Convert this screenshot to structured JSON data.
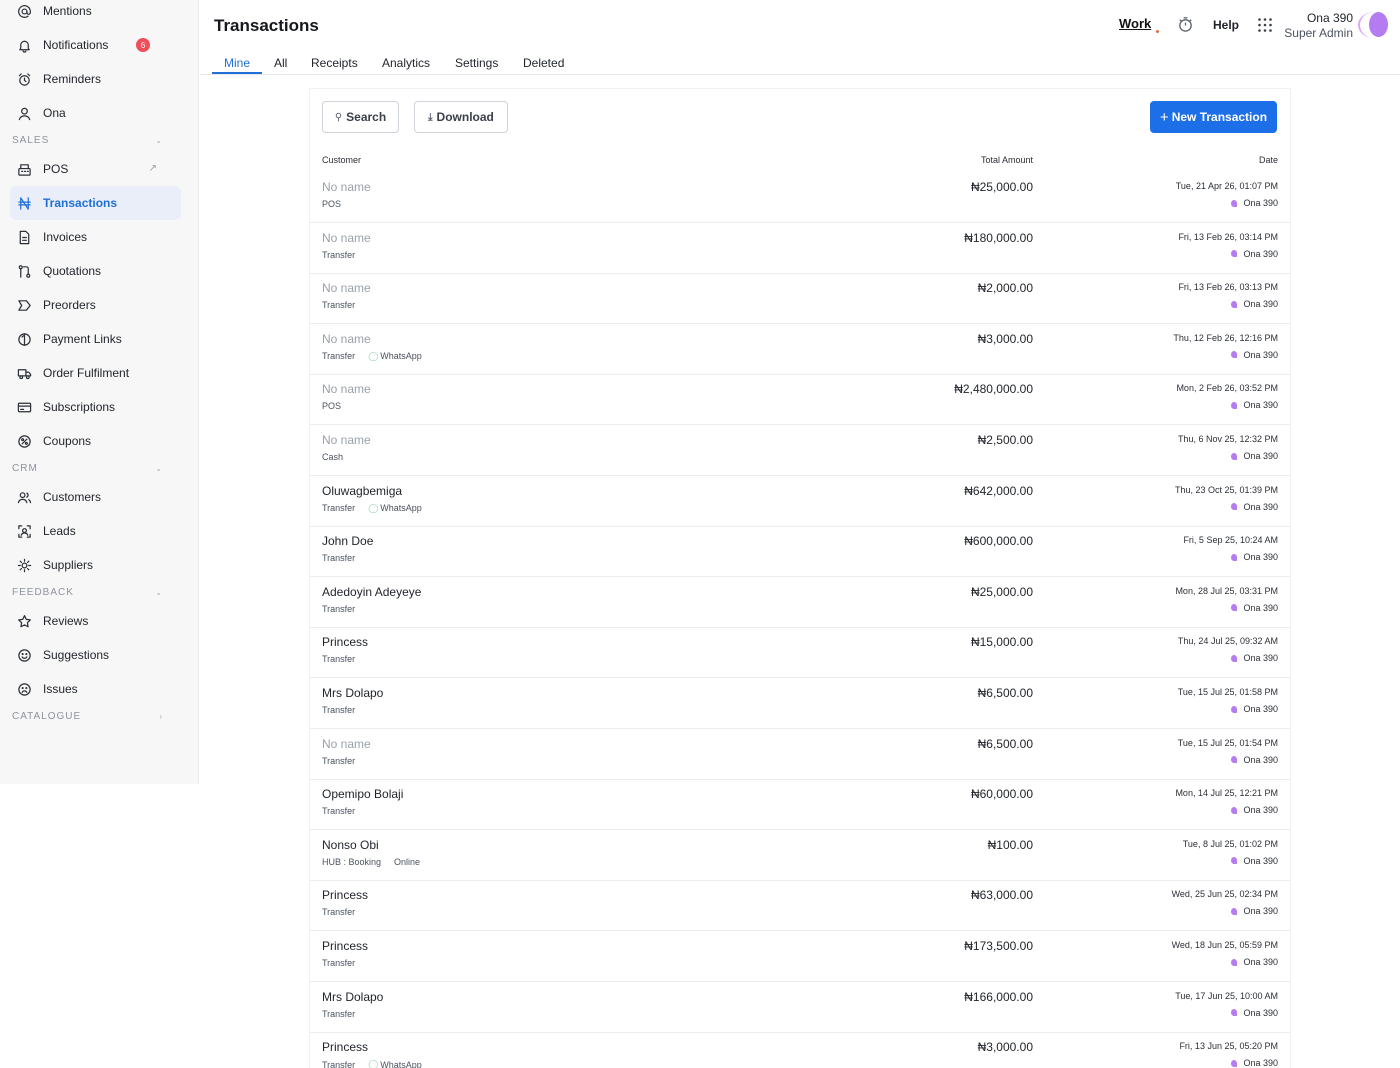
{
  "sidebar": {
    "items_top": [
      {
        "label": "Mentions",
        "icon": "at-icon"
      },
      {
        "label": "Notifications",
        "icon": "bell-icon",
        "badge": "6"
      },
      {
        "label": "Reminders",
        "icon": "alarm-icon"
      },
      {
        "label": "Ona",
        "icon": "user-icon"
      }
    ],
    "sections": [
      {
        "title": "SALES",
        "items": [
          {
            "label": "POS",
            "icon": "pos-icon"
          },
          {
            "label": "Transactions",
            "icon": "naira-icon"
          },
          {
            "label": "Invoices",
            "icon": "invoice-icon"
          },
          {
            "label": "Quotations",
            "icon": "quotation-icon"
          },
          {
            "label": "Preorders",
            "icon": "preorder-icon"
          },
          {
            "label": "Payment Links",
            "icon": "payment-link-icon"
          },
          {
            "label": "Order Fulfilment",
            "icon": "truck-icon"
          },
          {
            "label": "Subscriptions",
            "icon": "card-icon"
          },
          {
            "label": "Coupons",
            "icon": "coupon-icon"
          }
        ]
      },
      {
        "title": "CRM",
        "items": [
          {
            "label": "Customers",
            "icon": "users-icon"
          },
          {
            "label": "Leads",
            "icon": "lead-icon"
          },
          {
            "label": "Suppliers",
            "icon": "supplier-icon"
          }
        ]
      },
      {
        "title": "FEEDBACK",
        "items": [
          {
            "label": "Reviews",
            "icon": "star-icon"
          },
          {
            "label": "Suggestions",
            "icon": "smile-icon"
          },
          {
            "label": "Issues",
            "icon": "frown-icon"
          }
        ]
      },
      {
        "title": "CATALOGUE",
        "items": []
      }
    ],
    "chevron_down": "⌄",
    "chevron_right": "›",
    "external_arrow": "↗"
  },
  "header": {
    "title": "Transactions",
    "work_label": "Work",
    "help_label": "Help",
    "user_name": "Ona 390",
    "user_role": "Super Admin"
  },
  "tabs": [
    "Mine",
    "All",
    "Receipts",
    "Analytics",
    "Settings",
    "Deleted"
  ],
  "toolbar": {
    "search_label": "Search",
    "download_label": "Download",
    "new_label": "New Transaction",
    "search_glyph": "⚲",
    "download_glyph": "⤓",
    "plus_glyph": "+"
  },
  "table": {
    "columns": {
      "customer": "Customer",
      "amount": "Total Amount",
      "date": "Date"
    },
    "rows": [
      {
        "customer": "No name",
        "muted": true,
        "method": "POS",
        "tag": "",
        "amount": "₦25,000.00",
        "date": "Tue, 21 Apr 26, 01:07 PM",
        "by": "Ona 390"
      },
      {
        "customer": "No name",
        "muted": true,
        "method": "Transfer",
        "tag": "",
        "amount": "₦180,000.00",
        "date": "Fri, 13 Feb 26, 03:14 PM",
        "by": "Ona 390"
      },
      {
        "customer": "No name",
        "muted": true,
        "method": "Transfer",
        "tag": "",
        "amount": "₦2,000.00",
        "date": "Fri, 13 Feb 26, 03:13 PM",
        "by": "Ona 390"
      },
      {
        "customer": "No name",
        "muted": true,
        "method": "Transfer",
        "tag": "WhatsApp",
        "amount": "₦3,000.00",
        "date": "Thu, 12 Feb 26, 12:16 PM",
        "by": "Ona 390"
      },
      {
        "customer": "No name",
        "muted": true,
        "method": "POS",
        "tag": "",
        "amount": "₦2,480,000.00",
        "date": "Mon, 2 Feb 26, 03:52 PM",
        "by": "Ona 390"
      },
      {
        "customer": "No name",
        "muted": true,
        "method": "Cash",
        "tag": "",
        "amount": "₦2,500.00",
        "date": "Thu, 6 Nov 25, 12:32 PM",
        "by": "Ona 390"
      },
      {
        "customer": "Oluwagbemiga",
        "muted": false,
        "method": "Transfer",
        "tag": "WhatsApp",
        "amount": "₦642,000.00",
        "date": "Thu, 23 Oct 25, 01:39 PM",
        "by": "Ona 390"
      },
      {
        "customer": "John Doe",
        "muted": false,
        "method": "Transfer",
        "tag": "",
        "amount": "₦600,000.00",
        "date": "Fri, 5 Sep 25, 10:24 AM",
        "by": "Ona 390"
      },
      {
        "customer": "Adedoyin Adeyeye",
        "muted": false,
        "method": "Transfer",
        "tag": "",
        "amount": "₦25,000.00",
        "date": "Mon, 28 Jul 25, 03:31 PM",
        "by": "Ona 390"
      },
      {
        "customer": "Princess",
        "muted": false,
        "method": "Transfer",
        "tag": "",
        "amount": "₦15,000.00",
        "date": "Thu, 24 Jul 25, 09:32 AM",
        "by": "Ona 390"
      },
      {
        "customer": "Mrs Dolapo",
        "muted": false,
        "method": "Transfer",
        "tag": "",
        "amount": "₦6,500.00",
        "date": "Tue, 15 Jul 25, 01:58 PM",
        "by": "Ona 390"
      },
      {
        "customer": "No name",
        "muted": true,
        "method": "Transfer",
        "tag": "",
        "amount": "₦6,500.00",
        "date": "Tue, 15 Jul 25, 01:54 PM",
        "by": "Ona 390"
      },
      {
        "customer": "Opemipo Bolaji",
        "muted": false,
        "method": "Transfer",
        "tag": "",
        "amount": "₦60,000.00",
        "date": "Mon, 14 Jul 25, 12:21 PM",
        "by": "Ona 390"
      },
      {
        "customer": "Nonso Obi",
        "muted": false,
        "method": "HUB : Booking",
        "tag": "Online",
        "tag_plain": true,
        "amount": "₦100.00",
        "date": "Tue, 8 Jul 25, 01:02 PM",
        "by": "Ona 390"
      },
      {
        "customer": "Princess",
        "muted": false,
        "method": "Transfer",
        "tag": "",
        "amount": "₦63,000.00",
        "date": "Wed, 25 Jun 25, 02:34 PM",
        "by": "Ona 390"
      },
      {
        "customer": "Princess",
        "muted": false,
        "method": "Transfer",
        "tag": "",
        "amount": "₦173,500.00",
        "date": "Wed, 18 Jun 25, 05:59 PM",
        "by": "Ona 390"
      },
      {
        "customer": "Mrs Dolapo",
        "muted": false,
        "method": "Transfer",
        "tag": "",
        "amount": "₦166,000.00",
        "date": "Tue, 17 Jun 25, 10:00 AM",
        "by": "Ona 390"
      },
      {
        "customer": "Princess",
        "muted": false,
        "method": "Transfer",
        "tag": "WhatsApp",
        "amount": "₦3,000.00",
        "date": "Fri, 13 Jun 25, 05:20 PM",
        "by": "Ona 390"
      }
    ]
  },
  "colors": {
    "accent": "#1d6fe8",
    "badge": "#ef4f5a",
    "avatar": "#b47cf0",
    "tag": "#8fd4b0"
  }
}
